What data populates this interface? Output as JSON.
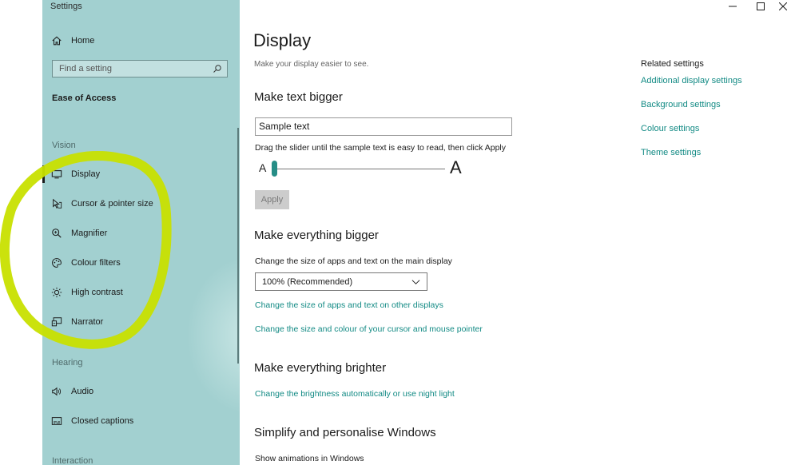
{
  "window": {
    "title": "Settings",
    "controls": {
      "minimize_icon": "minimize-icon",
      "maximize_icon": "maximize-icon",
      "close_icon": "close-icon"
    }
  },
  "sidebar": {
    "home_label": "Home",
    "search_placeholder": "Find a setting",
    "section_title": "Ease of Access",
    "groups": [
      {
        "label": "Vision",
        "items": [
          {
            "label": "Display",
            "icon": "monitor-icon",
            "selected": true
          },
          {
            "label": "Cursor & pointer size",
            "icon": "pointer-icon"
          },
          {
            "label": "Magnifier",
            "icon": "magnifier-icon"
          },
          {
            "label": "Colour filters",
            "icon": "palette-icon"
          },
          {
            "label": "High contrast",
            "icon": "sun-icon"
          },
          {
            "label": "Narrator",
            "icon": "narrator-icon"
          }
        ]
      },
      {
        "label": "Hearing",
        "items": [
          {
            "label": "Audio",
            "icon": "speaker-icon"
          },
          {
            "label": "Closed captions",
            "icon": "captions-icon"
          }
        ]
      },
      {
        "label": "Interaction",
        "items": []
      }
    ]
  },
  "main": {
    "title": "Display",
    "subtitle": "Make your display easier to see.",
    "text_bigger": {
      "heading": "Make text bigger",
      "sample_text": "Sample text",
      "hint": "Drag the slider until the sample text is easy to read, then click Apply",
      "slider_min_label": "A",
      "slider_max_label": "A",
      "slider_value_fraction": 0.0,
      "apply_label": "Apply"
    },
    "everything_bigger": {
      "heading": "Make everything bigger",
      "label": "Change the size of apps and text on the main display",
      "dropdown_value": "100% (Recommended)",
      "links": [
        "Change the size of apps and text on other displays",
        "Change the size and colour of your cursor and mouse pointer"
      ]
    },
    "everything_brighter": {
      "heading": "Make everything brighter",
      "link": "Change the brightness automatically or use night light"
    },
    "simplify": {
      "heading": "Simplify and personalise Windows",
      "label": "Show animations in Windows"
    }
  },
  "related": {
    "title": "Related settings",
    "links": [
      "Additional display settings",
      "Background settings",
      "Colour settings",
      "Theme settings"
    ]
  },
  "colors": {
    "sidebar_bg": "#a2d0d0",
    "accent": "#268d86",
    "link": "#128a84",
    "annotation": "#c8e000"
  }
}
